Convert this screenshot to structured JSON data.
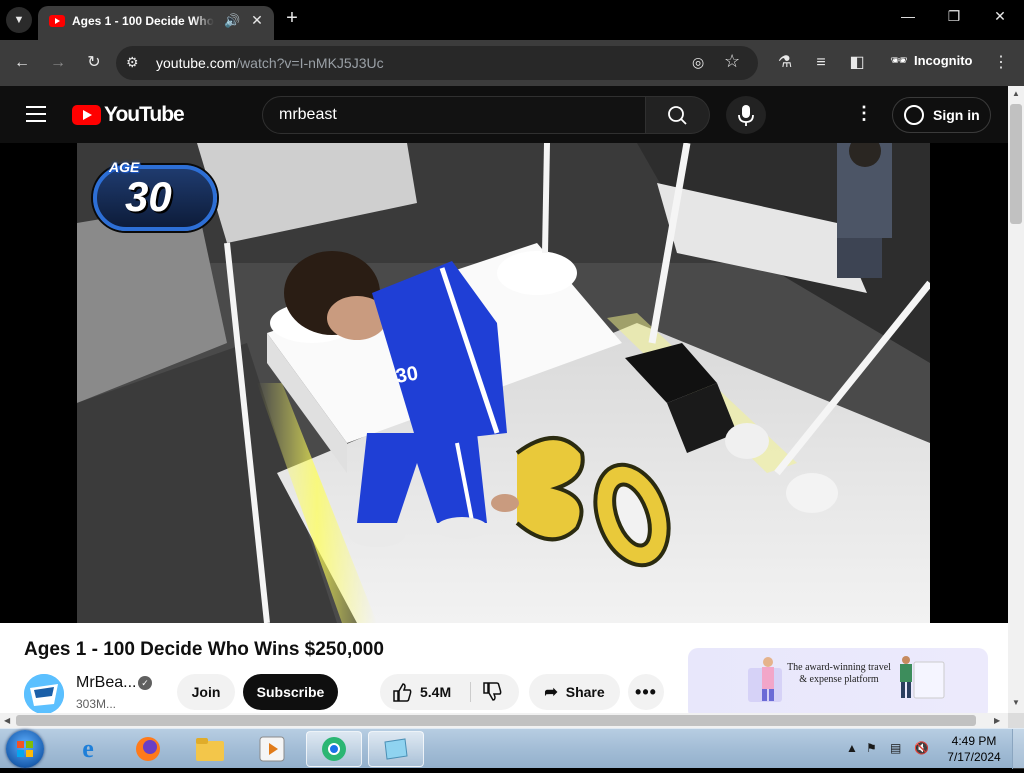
{
  "browser": {
    "tab": {
      "title": "Ages 1 - 100 Decide Who Wins $250,000",
      "audio_icon": "speaker-icon"
    },
    "url_host": "youtube.com",
    "url_path": "/watch?v=I-nMKJ5J3Uc",
    "incognito_label": "Incognito"
  },
  "youtube": {
    "logo_text": "YouTube",
    "search_value": "mrbeast",
    "signin_label": "Sign in"
  },
  "overlay": {
    "age_label": "AGE",
    "age_number": "30"
  },
  "video": {
    "title": "Ages 1 - 100 Decide Who Wins $250,000",
    "channel": "MrBea...",
    "subscribers": "303M...",
    "join_label": "Join",
    "subscribe_label": "Subscribe",
    "likes": "5.4M",
    "share_label": "Share"
  },
  "ad": {
    "text": "The award-winning travel & expense platform"
  },
  "taskbar": {
    "time": "4:49 PM",
    "date": "7/17/2024"
  },
  "colors": {
    "youtube_red": "#ff0000",
    "page_bg": "#0f0f0f",
    "subscribe_bg": "#0f0f0f"
  }
}
